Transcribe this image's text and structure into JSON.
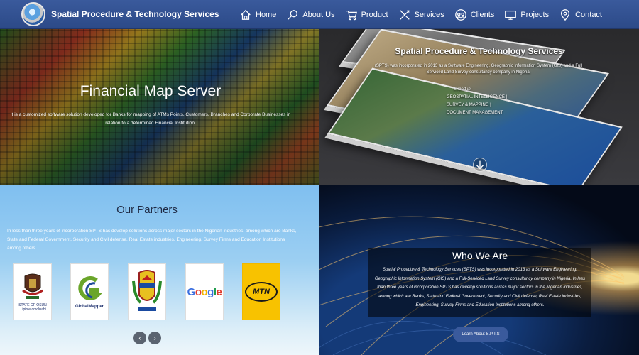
{
  "brand": {
    "name": "Spatial Procedure & Technology Services"
  },
  "nav": {
    "items": [
      {
        "label": "Home",
        "icon": "home-icon"
      },
      {
        "label": "About Us",
        "icon": "magnifier-icon"
      },
      {
        "label": "Product",
        "icon": "cart-icon"
      },
      {
        "label": "Services",
        "icon": "tools-icon"
      },
      {
        "label": "Clients",
        "icon": "clients-icon"
      },
      {
        "label": "Projects",
        "icon": "monitor-icon"
      },
      {
        "label": "Contact",
        "icon": "location-pin-icon"
      }
    ]
  },
  "financial": {
    "title": "Financial Map Server",
    "text": "It is a customized software solution developed for Banks for mapping of ATMs Points, Customers, Branches and Corporate Businesses in relation to a determined Financial Institution."
  },
  "spts": {
    "title": "Spatial Procedure & Technology Services",
    "intro": "(SPTS) was incorporated in 2013 as a Software Engineering, Geographic Information System (GIS) and a Full Serviced Land Survey consultancy company in Nigeria.",
    "expert_heading": "Expert in:",
    "expert_items": [
      "GEOSPATIAL INTELLIGENCE |",
      "SURVEY & MAPPING |",
      "DOCUMENT MANAGEMENT"
    ]
  },
  "partners": {
    "title": "Our Partners",
    "text": "In less than three years of incorporation SPTS has develop solutions across major sectors in the Nigerian industries, among which are Banks, State and Federal Government, Security and Civil defense, Real Estate industries, Engineering, Survey Firms and Education Institutions among others.",
    "logos": {
      "osun": "STATE OF OSUN",
      "osun_motto": "...ipinle omoluabi",
      "globalmapper": "GlobalMapper",
      "google": "Google",
      "mtn": "MTN"
    }
  },
  "who": {
    "title": "Who We Are",
    "text": "Spatial Procedure & Technology Services (SPTS) was incorporated in 2013 as a Software Engineering, Geographic Information System (GIS) and a Full-Serviced Land Survey consultancy company in Nigeria. In less than three years of incorporation SPTS has develop solutions across major sectors in the Nigerian industries, among which are Banks, State and Federal Government, Security and Civil defense, Real Estate industries, Engineering, Survey Firms and Education Institutions among others.",
    "button": "Learn About S.P.T.S"
  },
  "colors": {
    "nav_bg": "#3a5a9c",
    "accent": "#3a5a9c",
    "mtn_yellow": "#f8c200"
  }
}
